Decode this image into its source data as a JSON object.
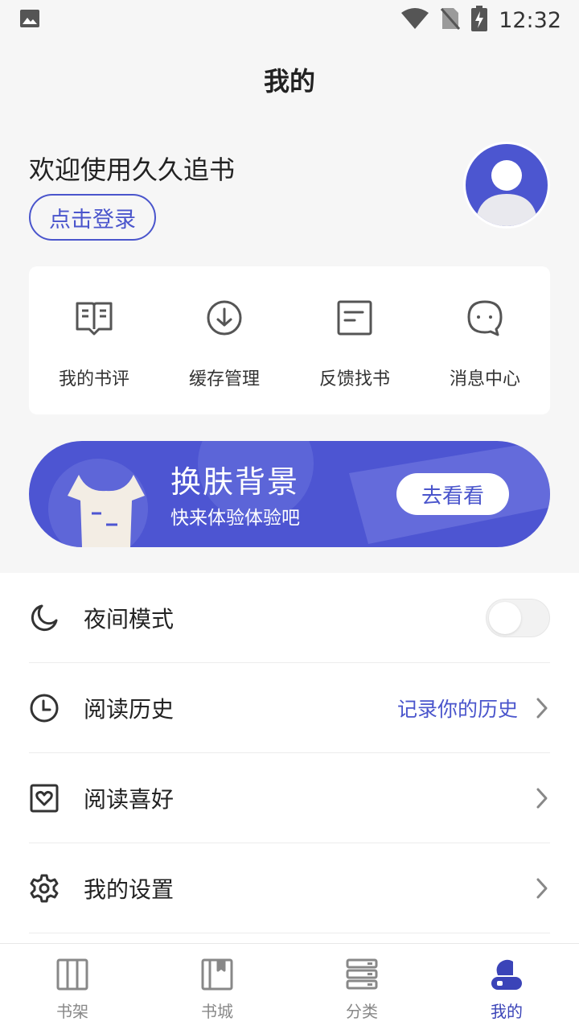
{
  "status_bar": {
    "time": "12:32"
  },
  "header": {
    "title": "我的"
  },
  "profile": {
    "welcome": "欢迎使用久久追书",
    "login_label": "点击登录"
  },
  "shortcuts": [
    {
      "label": "我的书评",
      "icon": "book-review-icon"
    },
    {
      "label": "缓存管理",
      "icon": "download-icon"
    },
    {
      "label": "反馈找书",
      "icon": "feedback-icon"
    },
    {
      "label": "消息中心",
      "icon": "message-icon"
    }
  ],
  "banner": {
    "title": "换肤背景",
    "subtitle": "快来体验体验吧",
    "button": "去看看"
  },
  "menu": {
    "night_mode": {
      "label": "夜间模式",
      "enabled": false
    },
    "history": {
      "label": "阅读历史",
      "value": "记录你的历史"
    },
    "preferences": {
      "label": "阅读喜好"
    },
    "settings": {
      "label": "我的设置"
    }
  },
  "bottom_nav": [
    {
      "label": "书架",
      "icon": "bookshelf-icon",
      "active": false
    },
    {
      "label": "书城",
      "icon": "bookstore-icon",
      "active": false
    },
    {
      "label": "分类",
      "icon": "category-icon",
      "active": false
    },
    {
      "label": "我的",
      "icon": "profile-icon",
      "active": true
    }
  ],
  "colors": {
    "accent": "#4a55cc",
    "banner": "#4d55d2",
    "background": "#f6f6f6"
  }
}
